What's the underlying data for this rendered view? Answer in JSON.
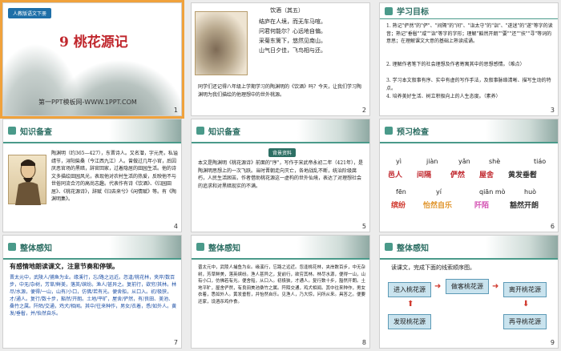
{
  "slide1": {
    "badge": "人教版语文下册",
    "title": "9 桃花源记",
    "site": "第一PPT模板网-WWW.1PPT.COM",
    "number": "1"
  },
  "slide2": {
    "poem_title": "饮酒（其五）",
    "poem_lines": [
      "结庐在人境，而无车马喧。",
      "问君何能尔？心远地自偏。",
      "采菊东篱下，悠然见南山。",
      "山气日夕佳，飞鸟相与还。"
    ],
    "text": "同学们还记得八年级上学期学习的陶渊明的《饮酒》吗？今天，让我们学习陶渊明为我们描绘的他理想中的世外桃源。",
    "number": "2"
  },
  "slide3": {
    "heading": "学习目标",
    "items": [
      "1. 熟记\"俨然\"的\"俨\"、\"间隔\"的\"间\"、\"诣太守\"的\"诣\"、\"遂迷\"的\"遂\"等字的读音；熟记\"垂髫\"\"咸\"\"诣\"等字的字形；理解\"豁然开朗\"\"要\"\"还\"\"扶\"\"寻\"等词的意思；在理解课文大意的基础上熟读成诵。",
      "2. 理解作者笔下的社会理想及作者寄寓其中的思想感情。（难点）",
      "3. 学习本文叙事有序、实中有虚的写作手法，及叙事脉络清晰、描写生动的特点。",
      "4. 培养美好生活、树立积极向上的人生态度。（素养）"
    ],
    "tag_difficult": "（重点）",
    "number": "3"
  },
  "slide4": {
    "heading": "知识备查",
    "text": "陶渊明（约365—427），东晋诗人。又名潜，字元亮，私谥靖节，浔阳柴桑（今江西九江）人。曾做过几年小官，后因厌恶官场的黑暗，辞官回家，过着隐居的田园生活。他的诗文多描绘田园风光，表现他对农村生活的热爱，反映他不与世俗同流合污的高尚志趣。代表作有诗《饮酒》、《归园田居》、《桃花源诗》，辞赋《归去来兮》《闲情赋》等。有《陶渊明集》。",
    "number": "4"
  },
  "slide5": {
    "heading": "知识备查",
    "tag": "背景资料",
    "text": "本文是陶渊明《桃花源诗》前面的\"序\"，写作于宋武帝永初二年（421年），是陶渊明思想上的一次飞跃。当时晋朝走向灭亡，各地战乱不断，统治阶级腐朽，人民生活困苦。作者借助桃花源这一虚构的世外仙境，表达了对理想社会的追求和对黑暗现实的不满。",
    "number": "5"
  },
  "slide6": {
    "heading": "预习检查",
    "pinyin_row1": [
      "yì",
      "jiàn",
      "yǎn",
      "shè",
      "tiáo"
    ],
    "hanzi_row1": [
      "邑人",
      "间隔",
      "俨然",
      "屋舍",
      "黄发垂髫"
    ],
    "pinyin_row2": [
      "fēn",
      "yí",
      "qiān mò",
      "huò"
    ],
    "hanzi_row2": [
      "缤纷",
      "怡然自乐",
      "阡陌",
      "豁然开朗"
    ],
    "number": "6"
  },
  "slide7": {
    "heading": "整体感知",
    "subtitle": "有感情地朗读课文，注意节奏和停顿。",
    "text": "晋太元中，武陵人/捕鱼为业。缘溪行，忘/路之远近。忽逢/桃花林，夹岸/数百步，中无/杂树，芳草/鲜美，落英/缤纷。渔人/甚异之。复前行，欲穷/其林。林尽/水源，便得/一山，山有/小口，仿佛/若有光。便舍船，从口入。初/极狭，才/通人。复行/数十步，豁然/开朗。土地/平旷，屋舍/俨然，有/良田、美池、桑竹之属。阡陌/交通，鸡犬/相闻。其中/往来种作，男女/衣着，悉/如外人。黄发/垂髫，并/怡然自乐。",
    "number": "7"
  },
  "slide8": {
    "heading": "整体感知",
    "text": "晋太元中，武陵人捕鱼为业。缘溪行，忘路之远近。忽逢桃花林，夹岸数百步，中无杂树，芳草鲜美，落英缤纷。渔人甚异之，复前行，欲穷其林。林尽水源，便得一山，山有小口，仿佛若有光。便舍船，从口入。初极狭，才通人。复行数十步，豁然开朗。土地平旷，屋舍俨然，有良田美池桑竹之属。阡陌交通，鸡犬相闻。其中往来种作，男女衣着，悉如外人。黄发垂髫，并怡然自乐。见渔人，乃大惊，问所从来。具答之。便要还家，设酒杀鸡作食。",
    "number": "8"
  },
  "slide9": {
    "heading": "整体感知",
    "subtitle": "读课文，完成下面的线索顺序图。",
    "boxes": [
      "进入桃花源",
      "做客桃花源",
      "离开桃花源",
      "发现桃花源",
      "再寻桃花源"
    ],
    "number": "9"
  },
  "colors": {
    "accent_red": "#c0272d",
    "accent_teal": "#2d6f64",
    "selected_outline": "#f0a23c"
  }
}
